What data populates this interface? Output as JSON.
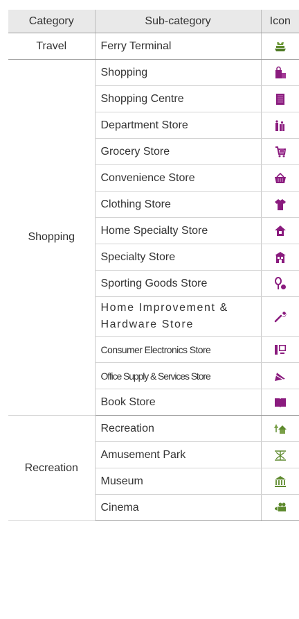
{
  "header": {
    "category": "Category",
    "subcategory": "Sub-category",
    "icon": "Icon"
  },
  "colors": {
    "accent": "#8a1b7e",
    "green": "#5e8a2e",
    "header_bg": "#e9e9e9"
  },
  "rows": [
    {
      "category": "Travel",
      "subcategory": "Ferry Terminal",
      "icon": "ferry-icon"
    },
    {
      "category": "Shopping",
      "subcategory": "Shopping",
      "icon": "shopping-bags-icon"
    },
    {
      "subcategory": "Shopping Centre",
      "icon": "shopping-centre-icon"
    },
    {
      "subcategory": "Department Store",
      "icon": "department-store-icon"
    },
    {
      "subcategory": "Grocery Store",
      "icon": "shopping-cart-icon"
    },
    {
      "subcategory": "Convenience Store",
      "icon": "basket-icon"
    },
    {
      "subcategory": "Clothing Store",
      "icon": "shirt-icon"
    },
    {
      "subcategory": "Home Specialty Store",
      "icon": "home-icon"
    },
    {
      "subcategory": "Specialty Store",
      "icon": "storefront-icon"
    },
    {
      "subcategory": "Sporting Goods Store",
      "icon": "racket-ball-icon"
    },
    {
      "subcategory": "Home Improvement & Hardware Store",
      "icon": "wrench-icon"
    },
    {
      "subcategory": "Consumer Electronics Store",
      "icon": "computer-icon"
    },
    {
      "subcategory": "Office Supply & Services Store",
      "icon": "ruler-triangle-icon"
    },
    {
      "subcategory": "Book Store",
      "icon": "book-icon"
    },
    {
      "category": "Recreation",
      "subcategory": "Recreation",
      "icon": "recreation-icon"
    },
    {
      "subcategory": "Amusement Park",
      "icon": "amusement-park-icon"
    },
    {
      "subcategory": "Museum",
      "icon": "museum-icon"
    },
    {
      "subcategory": "Cinema",
      "icon": "movie-camera-icon"
    }
  ]
}
